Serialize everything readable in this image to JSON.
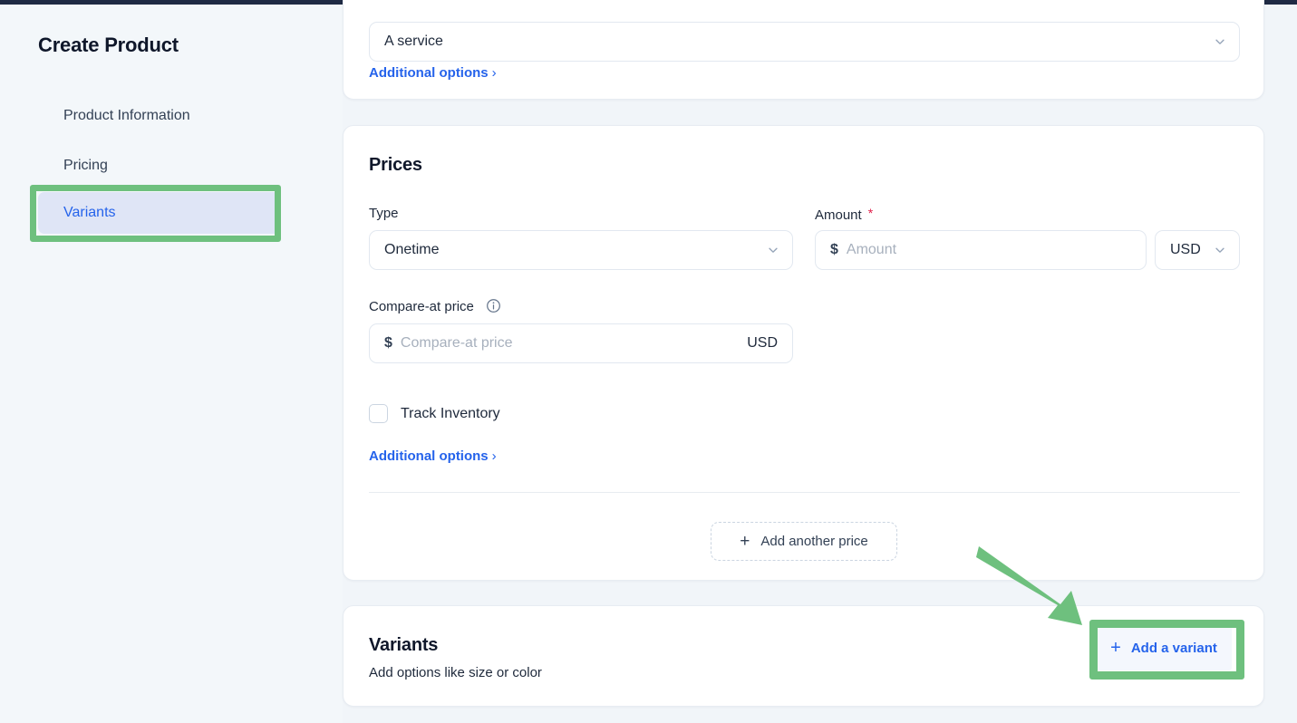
{
  "sidebar": {
    "title": "Create Product",
    "items": [
      {
        "label": "Product Information",
        "active": false
      },
      {
        "label": "Pricing",
        "active": false
      },
      {
        "label": "Variants",
        "active": true
      }
    ]
  },
  "product_type_card": {
    "select_value": "A service",
    "select_icon": "chevron-down-icon",
    "additional_options_label": "Additional options",
    "additional_options_caret": "›"
  },
  "prices_card": {
    "title": "Prices",
    "type_field": {
      "label": "Type",
      "value": "Onetime",
      "icon": "chevron-down-icon"
    },
    "amount_field": {
      "label": "Amount",
      "required_marker": "*",
      "currency_symbol": "$",
      "placeholder": "Amount",
      "value": ""
    },
    "currency_select": {
      "value": "USD",
      "icon": "chevron-down-icon"
    },
    "compare_at_field": {
      "label": "Compare-at price",
      "info_icon": "info-circle-icon",
      "currency_symbol": "$",
      "placeholder": "Compare-at price",
      "value": "",
      "suffix": "USD"
    },
    "track_inventory": {
      "label": "Track Inventory",
      "checked": false
    },
    "additional_options_label": "Additional options",
    "additional_options_caret": "›",
    "add_another_price": {
      "label": "Add another price",
      "icon": "plus-icon"
    }
  },
  "variants_card": {
    "title": "Variants",
    "subtitle": "Add options like size or color",
    "add_variant_button": {
      "label": "Add a variant",
      "icon": "plus-icon"
    }
  },
  "annotations": {
    "highlight_color": "#6ec07e",
    "arrow_color": "#6ec07e",
    "accent_color": "#2563eb",
    "active_nav_background": "#dfe5f6",
    "page_background": "#f1f5f9"
  }
}
